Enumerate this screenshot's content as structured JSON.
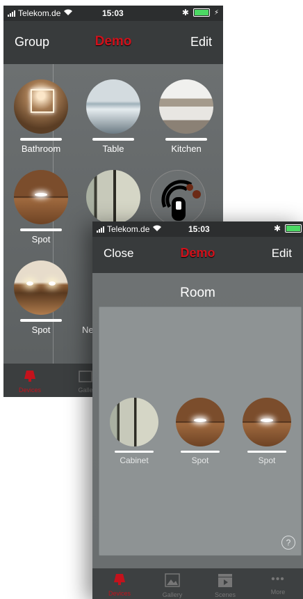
{
  "status": {
    "carrier": "Telekom.de",
    "time": "15:03"
  },
  "back_screen": {
    "nav": {
      "left": "Group",
      "title": "Demo",
      "right": "Edit"
    },
    "tiles": [
      {
        "label": "Bathroom"
      },
      {
        "label": "Table"
      },
      {
        "label": "Kitchen"
      },
      {
        "label": "Spot"
      },
      {
        "label": "Spot"
      },
      {
        "label": "Ne"
      }
    ],
    "tabs": [
      "Devices",
      "Galle"
    ]
  },
  "front_screen": {
    "nav": {
      "left": "Close",
      "title": "Demo",
      "right": "Edit"
    },
    "room_title": "Room",
    "tiles": [
      {
        "label": "Cabinet"
      },
      {
        "label": "Spot"
      },
      {
        "label": "Spot"
      }
    ],
    "help": "?",
    "tabs": [
      "Devices",
      "Gallery",
      "Scenes",
      "More"
    ]
  },
  "colors": {
    "accent": "#d0111b",
    "battery": "#4cd964"
  }
}
